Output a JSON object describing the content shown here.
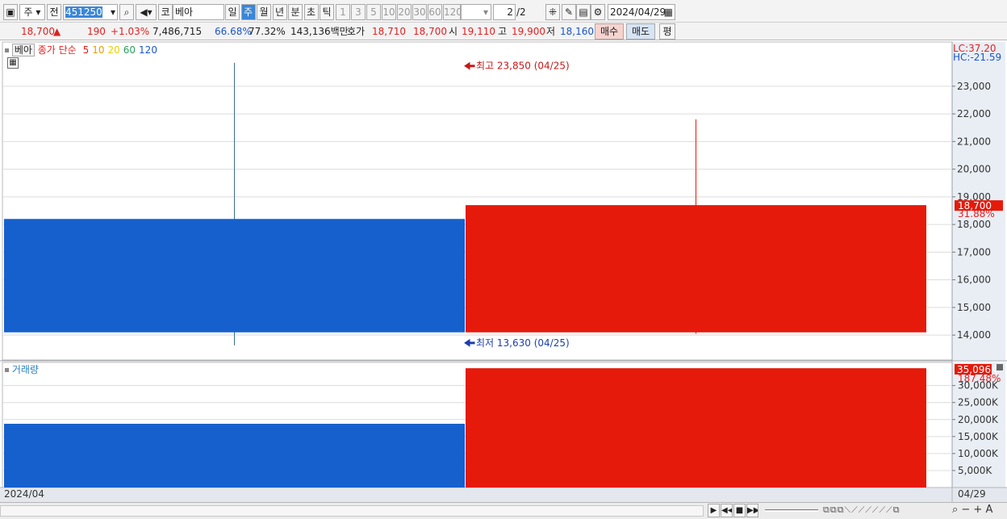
{
  "toolbar": {
    "period_type": "주",
    "prev_label": "전",
    "code": "451250",
    "market_label": "코",
    "name": "베아",
    "periods": [
      "일",
      "주",
      "월",
      "년",
      "분",
      "초",
      "틱"
    ],
    "active_period": "주",
    "intervals": [
      "1",
      "3",
      "5",
      "10",
      "20",
      "30",
      "60",
      "120"
    ],
    "page": "2",
    "page_total": "/2",
    "date": "2024/04/29"
  },
  "quote": {
    "price": "18,700",
    "change": "190",
    "change_pct": "+1.03%",
    "volume": "7,486,715",
    "ratio1": "66.68%",
    "ratio2": "77.32%",
    "amount": "143,136백만",
    "bid_label": "호가",
    "bid1": "18,710",
    "bid2": "18,700",
    "open_label": "시",
    "open": "19,110",
    "high_label": "고",
    "high": "19,900",
    "low_label": "저",
    "low": "18,160",
    "buy_label": "매수",
    "sell_label": "매도",
    "avg_label": "평"
  },
  "colors": {
    "up": "#e51a0a",
    "down": "#1560cc",
    "accent": "#3b86d6",
    "grid": "#dcdcdc"
  },
  "chart_data": [
    {
      "type": "candlestick",
      "legend": {
        "name": "베아",
        "series": "종가 단순",
        "ma": [
          {
            "period": "5",
            "color": "#e02020"
          },
          {
            "period": "10",
            "color": "#e0a000"
          },
          {
            "period": "20",
            "color": "#e8d000"
          },
          {
            "period": "60",
            "color": "#2aa060"
          },
          {
            "period": "120",
            "color": "#1c55c9"
          }
        ]
      },
      "candles": [
        {
          "open": 18200,
          "close": 14100,
          "high": 23850,
          "low": 13630,
          "color": "down"
        },
        {
          "open": 14100,
          "close": 18700,
          "high": 21800,
          "low": 14050,
          "color": "up"
        }
      ],
      "ylim": [
        13100,
        24600
      ],
      "yticks": [
        14000,
        15000,
        16000,
        17000,
        18000,
        19000,
        20000,
        21000,
        22000,
        23000
      ],
      "ytick_labels": [
        "14,000",
        "15,000",
        "16,000",
        "17,000",
        "18,000",
        "19,000",
        "20,000",
        "21,000",
        "22,000",
        "23,000"
      ],
      "high_annotation": "최고 23,850 (04/25)",
      "low_annotation": "최저 13,630 (04/25)",
      "lc_label": "LC:37.20",
      "hc_label": "HC:-21.59",
      "current_price_label": "18,700",
      "current_pct_label": "31.88%"
    },
    {
      "type": "bar",
      "title": "거래량",
      "values": [
        18750,
        35096
      ],
      "colors": [
        "down",
        "up"
      ],
      "ylim": [
        0,
        36800
      ],
      "yticks": [
        5000,
        10000,
        15000,
        20000,
        25000,
        30000
      ],
      "ytick_labels": [
        "5,000K",
        "10,000K",
        "15,000K",
        "20,000K",
        "25,000K",
        "30,000K"
      ],
      "current_label": "35,096K",
      "current_pct_label": "187.48%"
    }
  ],
  "xaxis": {
    "left_label": "2024/04",
    "right_label": "04/29"
  }
}
